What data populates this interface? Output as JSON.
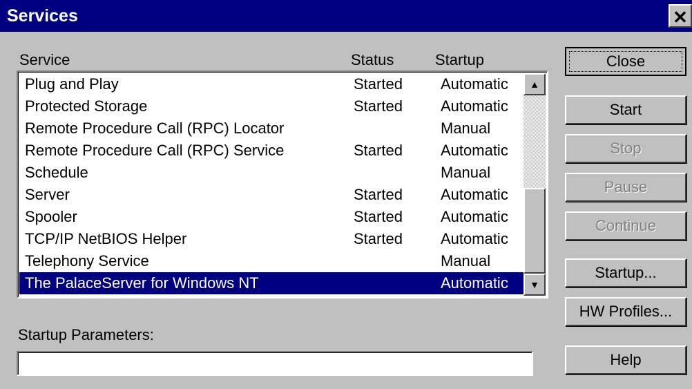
{
  "window": {
    "title": "Services",
    "close_glyph": "✕"
  },
  "columns": {
    "service": "Service",
    "status": "Status",
    "startup": "Startup"
  },
  "services": [
    {
      "name": "Plug and Play",
      "status": "Started",
      "startup": "Automatic"
    },
    {
      "name": "Protected Storage",
      "status": "Started",
      "startup": "Automatic"
    },
    {
      "name": "Remote Procedure Call (RPC) Locator",
      "status": "",
      "startup": "Manual"
    },
    {
      "name": "Remote Procedure Call (RPC) Service",
      "status": "Started",
      "startup": "Automatic"
    },
    {
      "name": "Schedule",
      "status": "",
      "startup": "Manual"
    },
    {
      "name": "Server",
      "status": "Started",
      "startup": "Automatic"
    },
    {
      "name": "Spooler",
      "status": "Started",
      "startup": "Automatic"
    },
    {
      "name": "TCP/IP NetBIOS Helper",
      "status": "Started",
      "startup": "Automatic"
    },
    {
      "name": "Telephony Service",
      "status": "",
      "startup": "Manual"
    },
    {
      "name": "The PalaceServer for Windows NT",
      "status": "",
      "startup": "Automatic",
      "selected": true
    }
  ],
  "buttons": {
    "close": "Close",
    "start": "Start",
    "stop": "Stop",
    "pause": "Pause",
    "continue": "Continue",
    "startup": "Startup...",
    "hw_profiles": "HW Profiles...",
    "help": "Help"
  },
  "startup_parameters": {
    "label": "Startup Parameters:",
    "value": ""
  },
  "scrollbar": {
    "up_glyph": "▲",
    "down_glyph": "▼"
  },
  "colors": {
    "titlebar": "#000080",
    "selection": "#000080",
    "face": "#c0c0c0"
  }
}
